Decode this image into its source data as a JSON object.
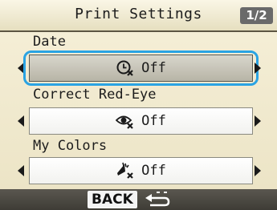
{
  "header": {
    "title": "Print Settings",
    "page_indicator": "1/2"
  },
  "settings": [
    {
      "label": "Date",
      "value": "Off",
      "icon": "date-off-icon",
      "selected": true
    },
    {
      "label": "Correct Red-Eye",
      "value": "Off",
      "icon": "red-eye-off-icon",
      "selected": false
    },
    {
      "label": "My Colors",
      "value": "Off",
      "icon": "my-colors-off-icon",
      "selected": false
    }
  ],
  "footer": {
    "back_label": "BACK",
    "back_icon": "return-arrow-icon"
  },
  "colors": {
    "focus": "#2aa3e3",
    "background": "#f3ecd2",
    "footer": "#4a4740"
  }
}
